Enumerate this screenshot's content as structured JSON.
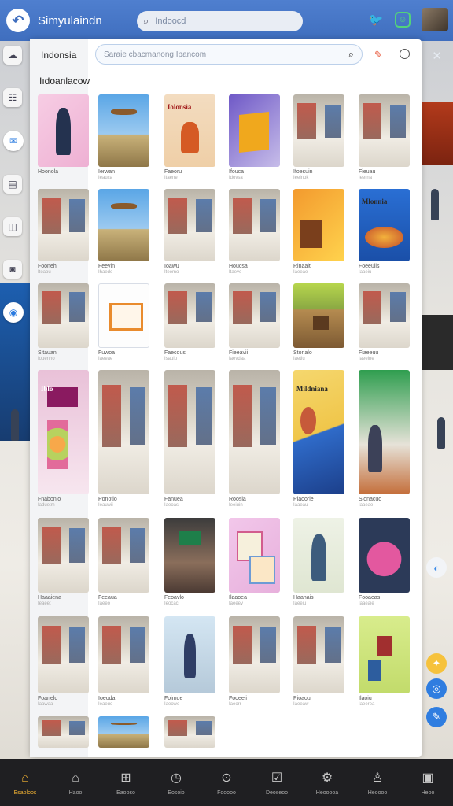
{
  "app": {
    "title": "Simyulaindn"
  },
  "top_search": {
    "placeholder": "Indoocd"
  },
  "panel": {
    "country": "Indonsia",
    "search_placeholder": "Saraie cbacmanong Ipancom",
    "section_title": "Iıdoanlacow"
  },
  "grid": {
    "rows": [
      [
        {
          "style": "t-pink",
          "label": "Hoonola",
          "sub": ""
        },
        {
          "style": "t-sky",
          "label": "Ierwan",
          "sub": "Ieauca"
        },
        {
          "style": "t-peach",
          "label": "Faeoru",
          "sub": "Itaene",
          "poster": "Iolonsia"
        },
        {
          "style": "t-purple",
          "label": "Ifouca",
          "sub": "Idovsa"
        },
        {
          "style": "t-store",
          "label": "Ifoesuin",
          "sub": "Ieeinok"
        },
        {
          "style": "t-store",
          "label": "Fieuau",
          "sub": "Ieerna"
        }
      ],
      [
        {
          "style": "t-store",
          "label": "Fooneh",
          "sub": "Itoaou"
        },
        {
          "style": "t-sky",
          "label": "Feevin",
          "sub": "Ihaede"
        },
        {
          "style": "t-store",
          "label": "Ioawu",
          "sub": "Iteomo"
        },
        {
          "style": "t-store",
          "label": "Houcsa",
          "sub": "Itaeve"
        },
        {
          "style": "t-orange",
          "label": "Rlnaaiti",
          "sub": "Iaeeae"
        },
        {
          "style": "t-blueposter",
          "label": "Foeeulis",
          "sub": "Iaaeiu",
          "poster": "Mlonnia"
        }
      ],
      [
        {
          "style": "t-store",
          "label": "Sitauan",
          "sub": "Iouenho"
        },
        {
          "style": "t-frame",
          "label": "Fuwoa",
          "sub": "Iaeeae"
        },
        {
          "style": "t-store",
          "label": "Faecous",
          "sub": "Isauiu"
        },
        {
          "style": "t-store",
          "label": "Fieeavii",
          "sub": "Iaevdaa"
        },
        {
          "style": "t-wood",
          "label": "Stonalo",
          "sub": "Iaetiu"
        },
        {
          "style": "t-store",
          "label": "Fiaeeuu",
          "sub": "Iaeeine"
        }
      ],
      [
        {
          "style": "t-kiosk",
          "label": "Fnabonlo",
          "sub": "Iaduetm",
          "poster": "Iblo"
        },
        {
          "style": "t-store",
          "label": "Ponotio",
          "sub": "Ieauwii"
        },
        {
          "style": "t-store",
          "label": "Fanuea",
          "sub": "Iaeoas"
        },
        {
          "style": "t-store",
          "label": "Roosia",
          "sub": "Ieeiuin"
        },
        {
          "style": "t-poster",
          "label": "Plaoorle",
          "sub": "Iaaeau",
          "poster": "Mildniana"
        },
        {
          "style": "t-green",
          "label": "Sionacuo",
          "sub": "Iaaeae"
        }
      ],
      [
        {
          "style": "t-store",
          "label": "Haaaiena",
          "sub": "Ieaeet"
        },
        {
          "style": "t-store",
          "label": "Feeaua",
          "sub": "Iaeeo"
        },
        {
          "style": "t-crowd",
          "label": "Feoavlo",
          "sub": "Ieocac"
        },
        {
          "style": "t-magazine",
          "label": "Ilaaoea",
          "sub": "Iaeeev"
        },
        {
          "style": "t-sketch",
          "label": "Haanais",
          "sub": "Iaeeiu"
        },
        {
          "style": "t-plate",
          "label": "Fooaeas",
          "sub": "Iaaeaie"
        }
      ],
      [
        {
          "style": "t-store",
          "label": "Foanelo",
          "sub": "Iaawaa"
        },
        {
          "style": "t-store",
          "label": "Ioeoda",
          "sub": "Ieaeuo"
        },
        {
          "style": "t-person",
          "label": "Foimoe",
          "sub": "Iaeowe"
        },
        {
          "style": "t-store",
          "label": "Fooeeli",
          "sub": "Iaeorr"
        },
        {
          "style": "t-store",
          "label": "Pioaou",
          "sub": "Iaeeaw"
        },
        {
          "style": "t-lime",
          "label": "Ilaoiu",
          "sub": "Iaeerea"
        }
      ],
      [
        {
          "style": "t-store",
          "label": "",
          "sub": ""
        },
        {
          "style": "t-sky",
          "label": "",
          "sub": ""
        },
        {
          "style": "t-store",
          "label": "",
          "sub": ""
        }
      ]
    ]
  },
  "bottom_nav": [
    {
      "icon": "home-icon",
      "glyph": "⌂",
      "label": "Esaoloos",
      "active": true
    },
    {
      "icon": "house-outline-icon",
      "glyph": "⌂",
      "label": "Haoo"
    },
    {
      "icon": "grid-icon",
      "glyph": "⊞",
      "label": "Eaooso"
    },
    {
      "icon": "clock-icon",
      "glyph": "◷",
      "label": "Eosoio"
    },
    {
      "icon": "pin-icon",
      "glyph": "⊙",
      "label": "Fooooo"
    },
    {
      "icon": "checklist-icon",
      "glyph": "☑",
      "label": "Deoseoo"
    },
    {
      "icon": "settings-icon",
      "glyph": "⚙",
      "label": "Heooooa"
    },
    {
      "icon": "person-icon",
      "glyph": "♙",
      "label": "Heoooo"
    },
    {
      "icon": "gallery-icon",
      "glyph": "▣",
      "label": "Heoo"
    }
  ],
  "colors": {
    "accent": "#3f6ebe",
    "nav_active": "#f2b233",
    "topbar": "#4f7fcf"
  }
}
